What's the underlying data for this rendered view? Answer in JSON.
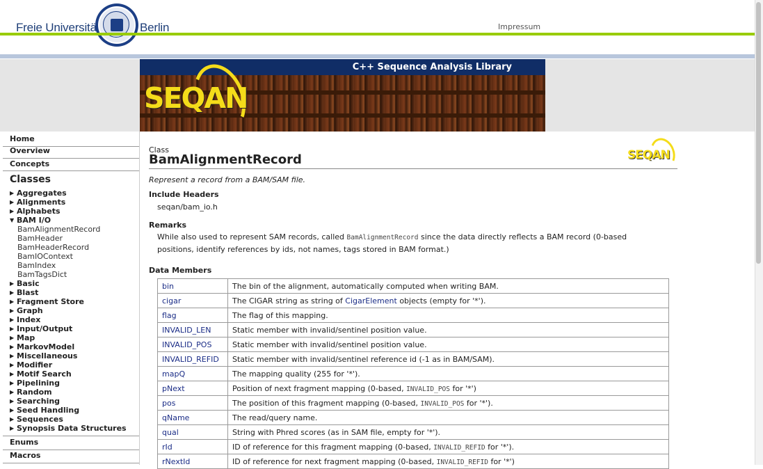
{
  "header": {
    "university_left": "Freie Universität",
    "university_right": "Berlin",
    "impressum": "Impressum"
  },
  "banner": {
    "title": "C++ Sequence Analysis Library",
    "logo_text": "SEQAN"
  },
  "sidebar": {
    "home": "Home",
    "overview": "Overview",
    "concepts": "Concepts",
    "classes_heading": "Classes",
    "items": [
      {
        "label": "Aggregates",
        "expanded": false
      },
      {
        "label": "Alignments",
        "expanded": false
      },
      {
        "label": "Alphabets",
        "expanded": false
      },
      {
        "label": "BAM I/O",
        "expanded": true
      },
      {
        "label": "Basic",
        "expanded": false
      },
      {
        "label": "Blast",
        "expanded": false
      },
      {
        "label": "Fragment Store",
        "expanded": false
      },
      {
        "label": "Graph",
        "expanded": false
      },
      {
        "label": "Index",
        "expanded": false
      },
      {
        "label": "Input/Output",
        "expanded": false
      },
      {
        "label": "Map",
        "expanded": false
      },
      {
        "label": "MarkovModel",
        "expanded": false
      },
      {
        "label": "Miscellaneous",
        "expanded": false
      },
      {
        "label": "Modifier",
        "expanded": false
      },
      {
        "label": "Motif Search",
        "expanded": false
      },
      {
        "label": "Pipelining",
        "expanded": false
      },
      {
        "label": "Random",
        "expanded": false
      },
      {
        "label": "Searching",
        "expanded": false
      },
      {
        "label": "Seed Handling",
        "expanded": false
      },
      {
        "label": "Sequences",
        "expanded": false
      },
      {
        "label": "Synopsis Data Structures",
        "expanded": false
      }
    ],
    "bam_children": [
      "BamAlignmentRecord",
      "BamHeader",
      "BamHeaderRecord",
      "BamIOContext",
      "BamIndex",
      "BamTagsDict"
    ],
    "enums": "Enums",
    "macros": "Macros"
  },
  "main": {
    "kind": "Class",
    "title": "BamAlignmentRecord",
    "brief": "Represent a record from a BAM/SAM file.",
    "include_heading": "Include Headers",
    "include_value": "seqan/bam_io.h",
    "remarks_heading": "Remarks",
    "remarks_pre": "While also used to represent SAM records, called ",
    "remarks_code": "BamAlignmentRecord",
    "remarks_post_line1": " since the data directly reflects a BAM record (0-based",
    "remarks_line2": "positions, identify references by ids, not names, tags stored in BAM format.)",
    "members_heading": "Data Members",
    "members": [
      {
        "name": "bin",
        "pre": "The bin of the alignment, automatically computed when writing BAM.",
        "link": "",
        "code": "",
        "post": ""
      },
      {
        "name": "cigar",
        "pre": "The CIGAR string as string of ",
        "link": "CigarElement",
        "code": "",
        "post": " objects (empty for '*')."
      },
      {
        "name": "flag",
        "pre": "The flag of this mapping.",
        "link": "",
        "code": "",
        "post": ""
      },
      {
        "name": "INVALID_LEN",
        "pre": "Static member with invalid/sentinel position value.",
        "link": "",
        "code": "",
        "post": ""
      },
      {
        "name": "INVALID_POS",
        "pre": "Static member with invalid/sentinel position value.",
        "link": "",
        "code": "",
        "post": ""
      },
      {
        "name": "INVALID_REFID",
        "pre": "Static member with invalid/sentinel reference id (-1 as in BAM/SAM).",
        "link": "",
        "code": "",
        "post": ""
      },
      {
        "name": "mapQ",
        "pre": "The mapping quality (255 for '*').",
        "link": "",
        "code": "",
        "post": ""
      },
      {
        "name": "pNext",
        "pre": "Position of next fragment mapping (0-based, ",
        "link": "",
        "code": "INVALID_POS",
        "post": " for '*')"
      },
      {
        "name": "pos",
        "pre": "The position of this fragment mapping (0-based, ",
        "link": "",
        "code": "INVALID_POS",
        "post": " for '*')."
      },
      {
        "name": "qName",
        "pre": "The read/query name.",
        "link": "",
        "code": "",
        "post": ""
      },
      {
        "name": "qual",
        "pre": "String with Phred scores (as in SAM file, empty for '*').",
        "link": "",
        "code": "",
        "post": ""
      },
      {
        "name": "rId",
        "pre": "ID of reference for this fragment mapping (0-based, ",
        "link": "",
        "code": "INVALID_REFID",
        "post": " for '*')."
      },
      {
        "name": "rNextId",
        "pre": "ID of reference for next fragment mapping (0-based, ",
        "link": "",
        "code": "INVALID_REFID",
        "post": " for '*')"
      }
    ]
  }
}
